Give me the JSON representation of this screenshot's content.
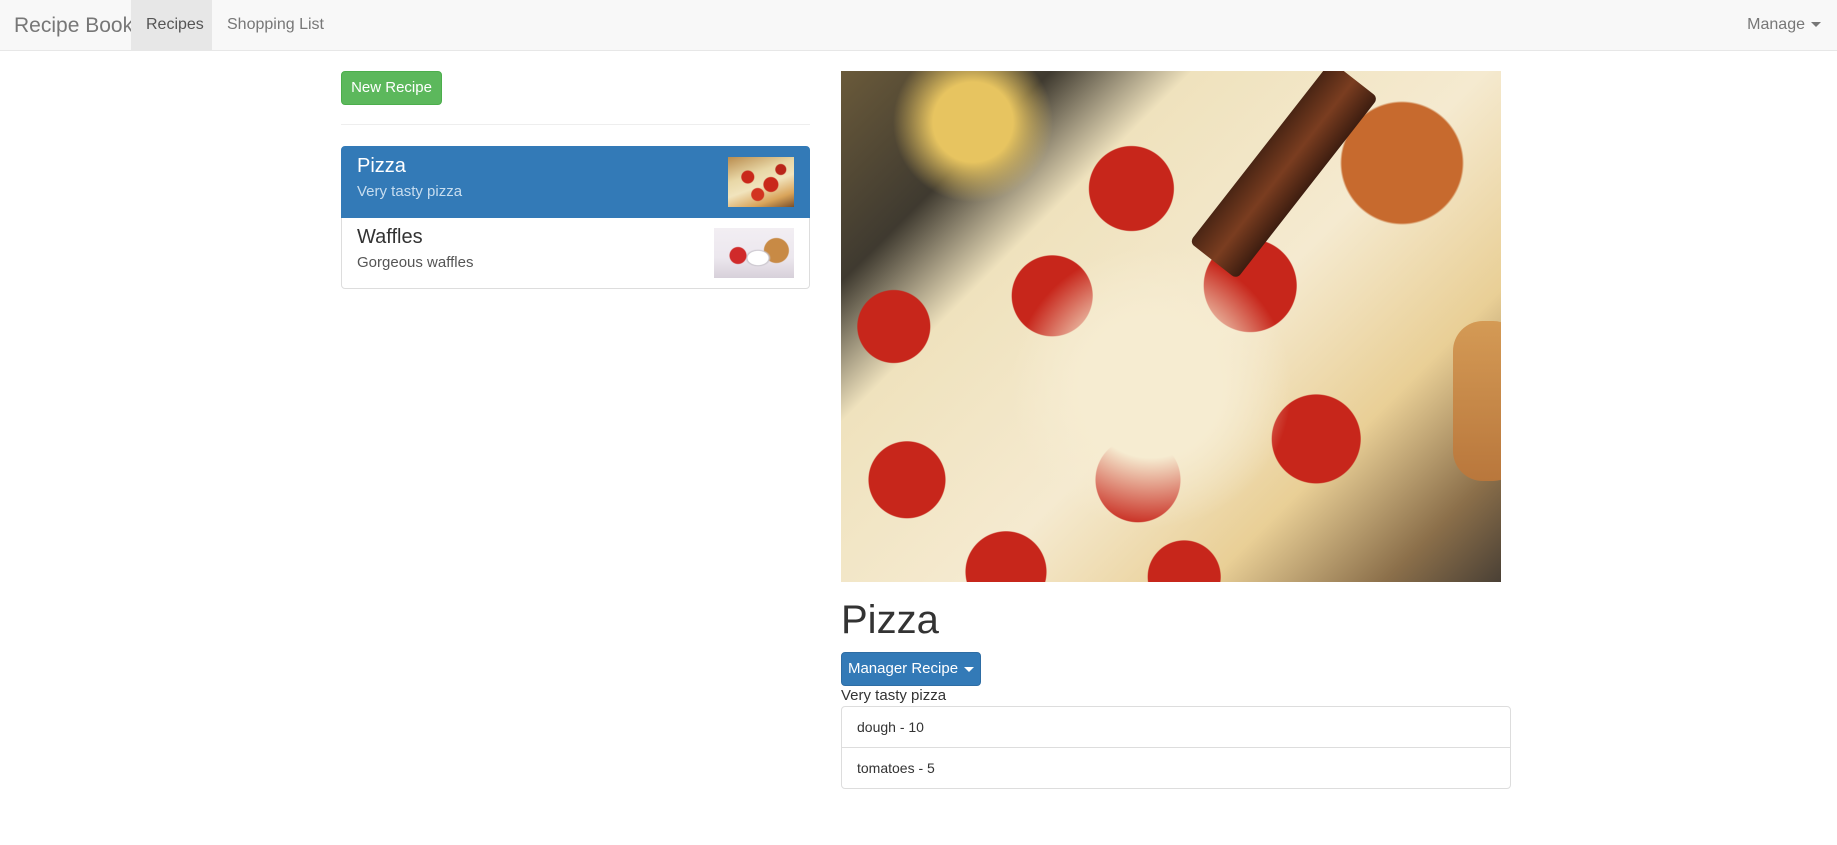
{
  "navbar": {
    "brand": "Recipe Book",
    "items": [
      {
        "label": "Recipes",
        "active": true
      },
      {
        "label": "Shopping List",
        "active": false
      }
    ],
    "manage_label": "Manage"
  },
  "sidebar": {
    "new_recipe_label": "New Recipe",
    "recipes": [
      {
        "name": "Pizza",
        "description": "Very tasty pizza",
        "active": true,
        "thumbnail": "pizza-thumbnail"
      },
      {
        "name": "Waffles",
        "description": "Gorgeous waffles",
        "active": false,
        "thumbnail": "waffles-thumbnail"
      }
    ]
  },
  "detail": {
    "image": "pizza-photo",
    "title": "Pizza",
    "manage_button_label": "Manager Recipe",
    "description": "Very tasty pizza",
    "ingredients": [
      "dough - 10",
      "tomatoes - 5"
    ]
  },
  "colors": {
    "success": "#5cb85c",
    "primary": "#337ab7",
    "navbar_bg": "#f8f8f8"
  }
}
